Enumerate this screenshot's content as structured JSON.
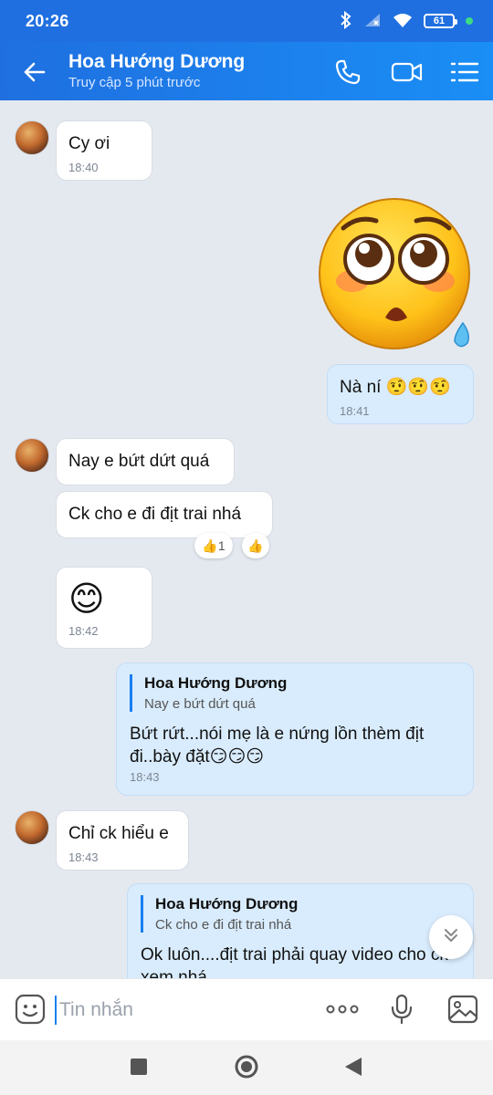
{
  "status_bar": {
    "time": "20:26",
    "battery": "61"
  },
  "header": {
    "contact_name": "Hoa Hướng Dương",
    "contact_status": "Truy cập 5 phút trước"
  },
  "messages": [
    {
      "text": "Cy ơi",
      "time": "18:40"
    },
    {
      "text": "Nà ní 🤨🤨🤨",
      "time": "18:41"
    },
    {
      "text": "Nay e bứt dứt quá"
    },
    {
      "text": "Ck cho e đi địt trai nhá",
      "reactions": [
        "👍1",
        "👍"
      ]
    },
    {
      "text": "😊",
      "time": "18:42"
    },
    {
      "quote_name": "Hoa Hướng Dương",
      "quote_text": "Nay e bứt dứt quá",
      "text": "Bứt rứt...nói mẹ là e nứng lồn thèm địt đi..bày đặt😏😏😏",
      "time": "18:43"
    },
    {
      "text": "Chỉ ck hiểu e",
      "time": "18:43"
    },
    {
      "quote_name": "Hoa Hướng Dương",
      "quote_text": "Ck cho e đi địt trai nhá",
      "text": "Ok luôn....địt trai phải quay video cho ck xem nhá"
    }
  ],
  "composer": {
    "placeholder": "Tin nhắn"
  },
  "icons": [
    "back-arrow-icon",
    "phone-icon",
    "video-call-icon",
    "menu-icon",
    "sticker-icon",
    "more-icon",
    "mic-icon",
    "image-icon",
    "chevron-double-down-icon",
    "flushed-sticker-icon"
  ],
  "colors": {
    "header_blue": "#1f6fe0",
    "my_bubble": "#d9ecfd",
    "chat_bg": "#e4e9f0",
    "accent": "#1a7ef0"
  }
}
